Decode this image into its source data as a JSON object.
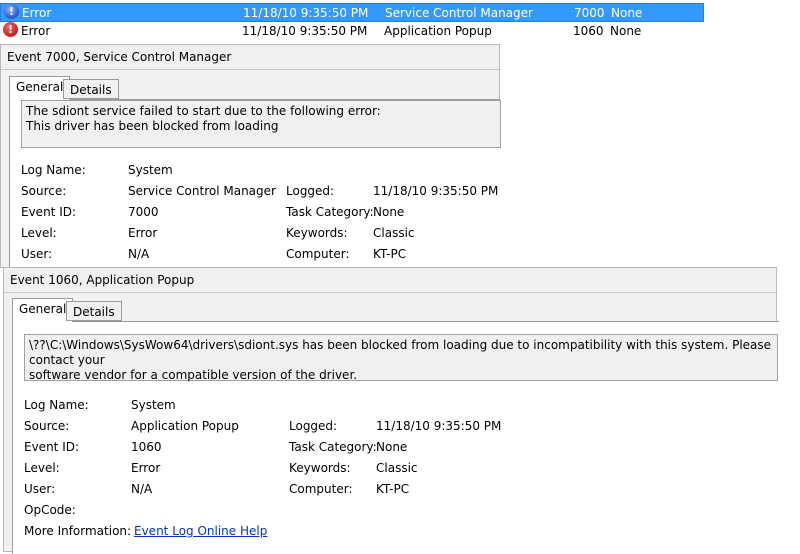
{
  "event_list": [
    {
      "level": "Error",
      "date": "11/18/10 9:35:50 PM",
      "source": "Service Control Manager",
      "event_id": "7000",
      "category": "None",
      "selected": true
    },
    {
      "level": "Error",
      "date": "11/18/10 9:35:50 PM",
      "source": "Application Popup",
      "event_id": "1060",
      "category": "None",
      "selected": false
    }
  ],
  "panel1": {
    "title": "Event 7000, Service Control Manager",
    "tab_general": "General",
    "tab_details": "Details",
    "message_line1": "The sdiont service failed to start due to the following error:",
    "message_line2": "This driver has been blocked from loading",
    "log_name_label": "Log Name:",
    "log_name": "System",
    "source_label": "Source:",
    "source": "Service Control Manager",
    "logged_label": "Logged:",
    "logged": "11/18/10 9:35:50 PM",
    "event_id_label": "Event ID:",
    "event_id": "7000",
    "task_category_label": "Task Category:",
    "task_category": "None",
    "level_label": "Level:",
    "level": "Error",
    "keywords_label": "Keywords:",
    "keywords": "Classic",
    "user_label": "User:",
    "user": "N/A",
    "computer_label": "Computer:",
    "computer": "KT-PC"
  },
  "panel2": {
    "title": "Event 1060, Application Popup",
    "tab_general": "General",
    "tab_details": "Details",
    "message_line1": "\\??\\C:\\Windows\\SysWow64\\drivers\\sdiont.sys has been blocked from loading due to incompatibility with this system. Please contact your",
    "message_line2": "software vendor for a compatible version of the driver.",
    "log_name_label": "Log Name:",
    "log_name": "System",
    "source_label": "Source:",
    "source": "Application Popup",
    "logged_label": "Logged:",
    "logged": "11/18/10 9:35:50 PM",
    "event_id_label": "Event ID:",
    "event_id": "1060",
    "task_category_label": "Task Category:",
    "task_category": "None",
    "level_label": "Level:",
    "level": "Error",
    "keywords_label": "Keywords:",
    "keywords": "Classic",
    "user_label": "User:",
    "user": "N/A",
    "computer_label": "Computer:",
    "computer": "KT-PC",
    "opcode_label": "OpCode:",
    "more_info_label": "More Information:",
    "more_info_link": "Event Log Online Help"
  }
}
